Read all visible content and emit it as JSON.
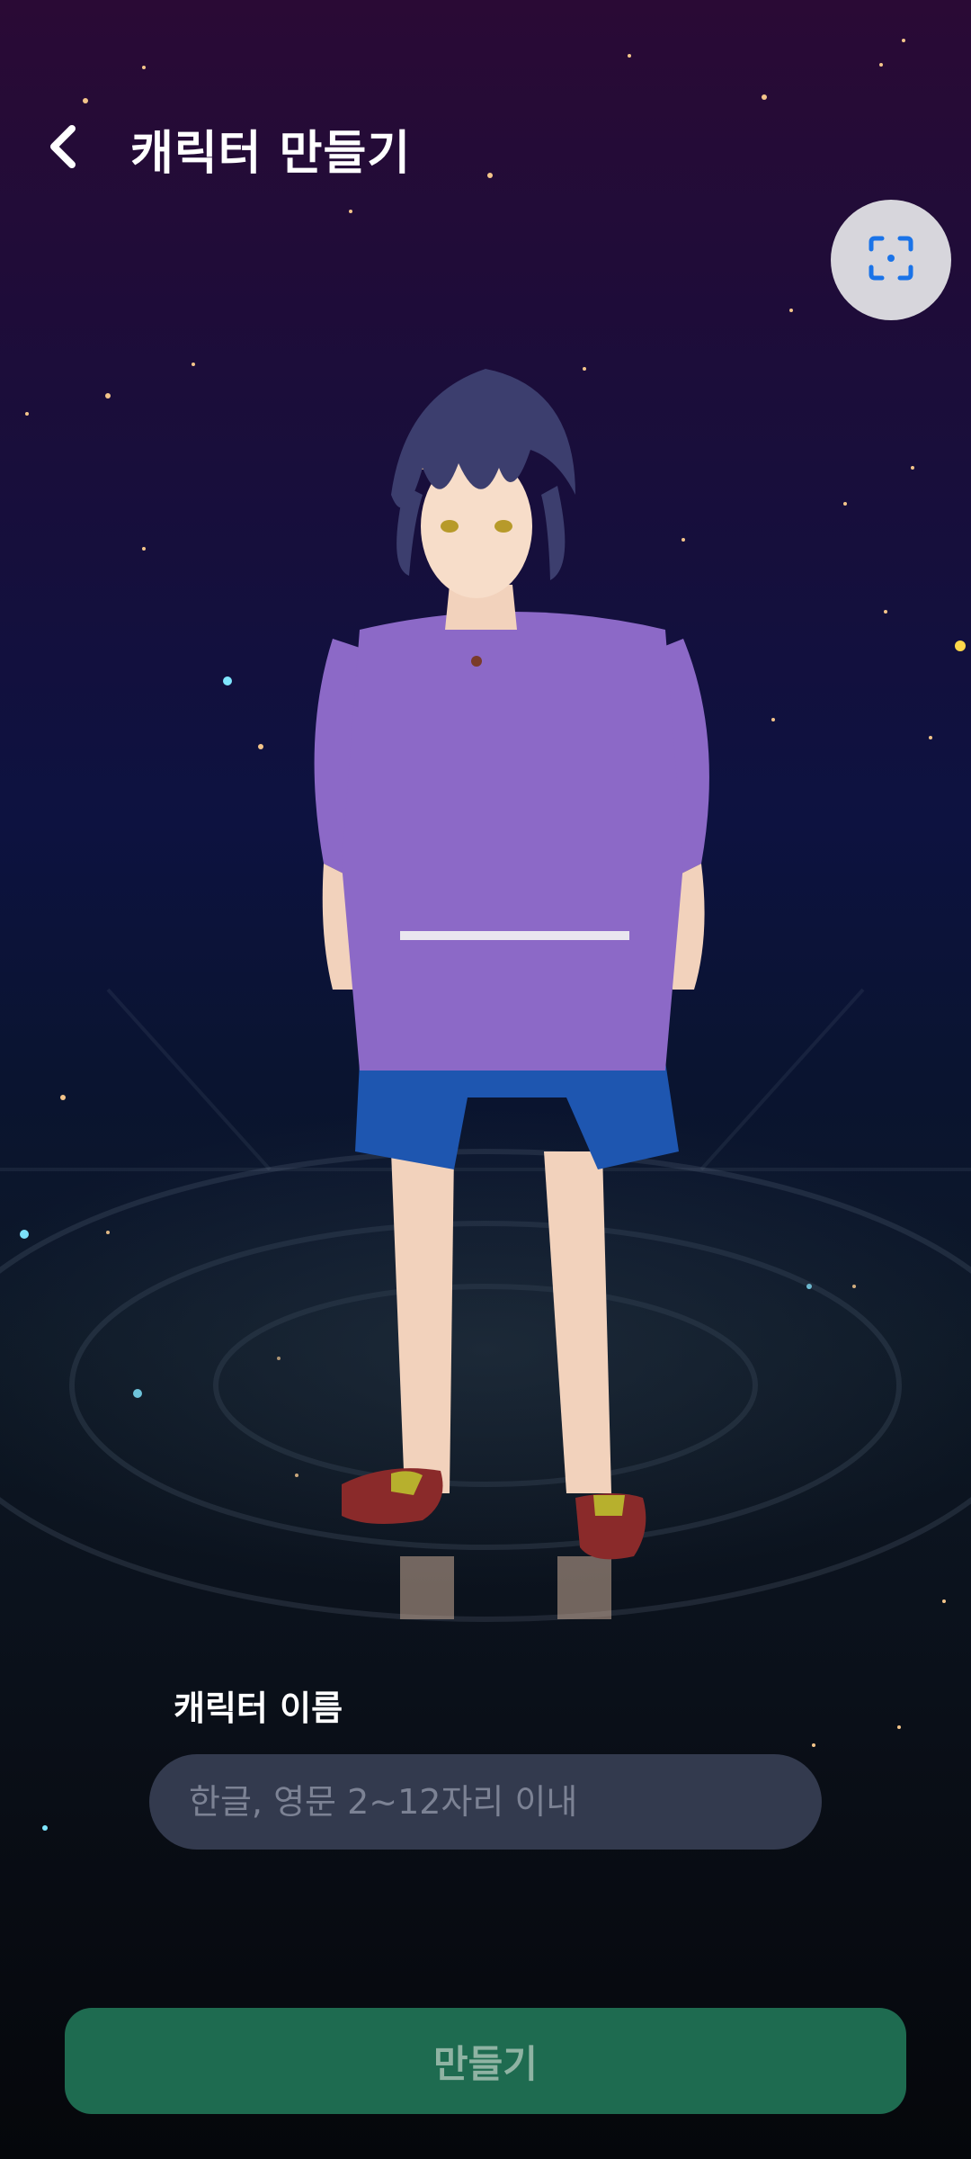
{
  "header": {
    "back_icon": "chevron-left-icon",
    "title": "캐릭터 만들기",
    "scan_icon": "focus-frame-icon",
    "accent": "#1a73e8"
  },
  "form": {
    "name_label": "캐릭터 이름",
    "name_value": "",
    "name_placeholder": "한글, 영문 2~12자리 이내"
  },
  "actions": {
    "create_label": "만들기",
    "create_color": "#1e6b50"
  }
}
